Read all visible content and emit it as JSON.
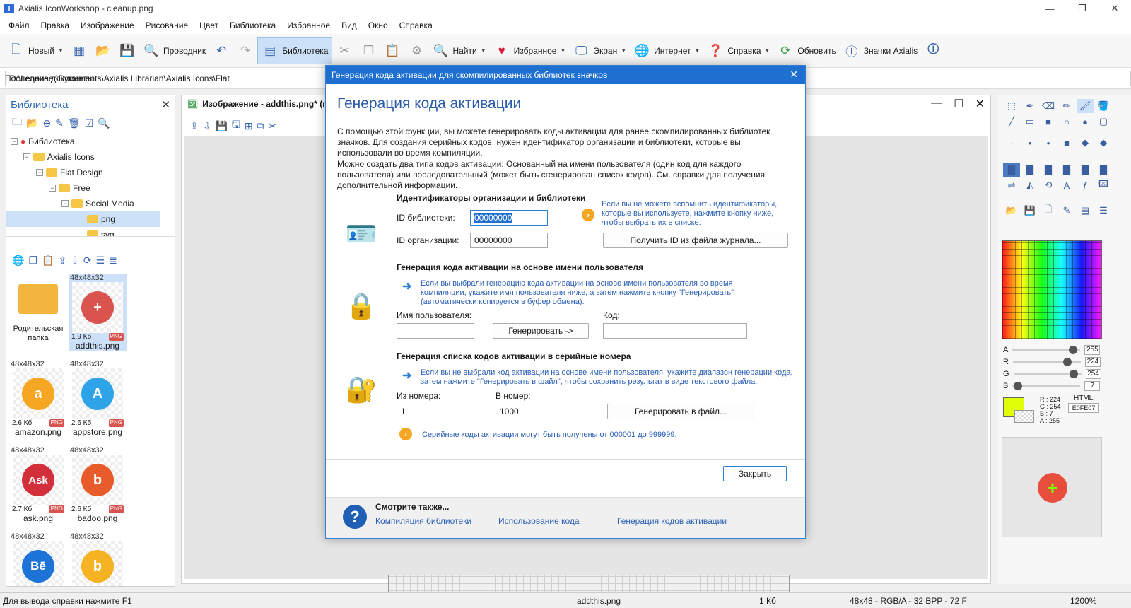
{
  "window": {
    "title": "Axialis IconWorkshop - cleanup.png",
    "app_letter": "I",
    "min": "—",
    "max": "❐",
    "close": "✕"
  },
  "menu": [
    "Файл",
    "Правка",
    "Изображение",
    "Рисование",
    "Цвет",
    "Библиотека",
    "Избранное",
    "Вид",
    "Окно",
    "Справка"
  ],
  "toolbar": {
    "new": "Новый",
    "explorer": "Проводник",
    "library": "Библиотека",
    "find": "Найти",
    "favorites": "Избранное",
    "screen": "Экран",
    "internet": "Интернет",
    "help": "Справка",
    "update": "Обновить",
    "axialis_icons": "Значки Axialis"
  },
  "recent": {
    "label": "Последние документы",
    "path": "D:\\Lenouser\\Documents\\Axialis Librarian\\Axialis Icons\\Flat"
  },
  "library_panel": {
    "title": "Библиотека",
    "tree": [
      "Библиотека",
      "Axialis Icons",
      "Flat Design",
      "Free",
      "Social Media",
      "png",
      "svg"
    ],
    "thumbs": [
      {
        "dim": "",
        "name": "Родительская папка",
        "size": "",
        "type": ""
      },
      {
        "dim": "48x48x32",
        "name": "addthis.png",
        "size": "1.9 Кб",
        "type": "PNG"
      },
      {
        "dim": "48x48x32",
        "name": "amazon.png",
        "size": "2.6 Кб",
        "type": "PNG",
        "glyph": "a"
      },
      {
        "dim": "48x48x32",
        "name": "appstore.png",
        "size": "2.6 Кб",
        "type": "PNG",
        "glyph": "A"
      },
      {
        "dim": "48x48x32",
        "name": "ask.png",
        "size": "2.7 Кб",
        "type": "PNG",
        "glyph": "Ask"
      },
      {
        "dim": "48x48x32",
        "name": "badoo.png",
        "size": "2.6 Кб",
        "type": "PNG",
        "glyph": "b"
      },
      {
        "dim": "48x48x32",
        "name": "",
        "size": "",
        "type": "",
        "glyph": "Bē"
      },
      {
        "dim": "48x48x32",
        "name": "",
        "size": "",
        "type": "",
        "glyph": "b"
      }
    ]
  },
  "document": {
    "title": "Изображение - addthis.png* (r"
  },
  "color_panel": {
    "sliders": [
      {
        "k": "A",
        "v": "255",
        "f": 0.95
      },
      {
        "k": "R",
        "v": "224",
        "f": 0.85
      },
      {
        "k": "G",
        "v": "254",
        "f": 0.95
      },
      {
        "k": "B",
        "v": "7",
        "f": 0.02
      }
    ],
    "rgb": "R : 224\nG : 254\nB : 7\nA : 255",
    "html_label": "HTML:",
    "html_value": "E0FE07",
    "swatch": "#e0fe07"
  },
  "status": {
    "hint": "Для вывода справки нажмите F1",
    "file": "addthis.png",
    "size": "1 Кб",
    "format": "48x48 - RGB/A - 32 BPP - 72 F",
    "zoom": "1200%"
  },
  "dialog": {
    "title": "Генерация кода активации для скомпилированных библиотек значков",
    "heading": "Генерация кода активации",
    "intro1": "С помощью этой функции, вы можете генерировать коды активации для ранее скомпилированных библиотек значков. Для создания серийных кодов, нужен идентификатор организации и библиотеки, которые вы использовали во время компиляции.",
    "intro2": "Можно создать два типа кодов активации: Основанный на имени пользователя (один код для каждого пользователя) или последовательный (может быть сгенерирован список кодов). См. справки для получения дополнительной информации.",
    "ids": {
      "section": "Идентификаторы организации и библиотеки",
      "lib_label": "ID библиотеки:",
      "lib_value": "00000000",
      "org_label": "ID организации:",
      "org_value": "00000000",
      "hint": "Если вы не можете вспомнить идентификаторы, которые вы используете, нажмите кнопку ниже, чтобы выбрать их в списке:",
      "button": "Получить ID из файла журнала..."
    },
    "user": {
      "section": "Генерация кода активации на основе имени пользователя",
      "hint": "Если вы выбрали генерацию кода активации на основе имени пользователя во время компиляции, укажите имя пользователя ниже, а затем нажмите кнопку \"Генерировать\" (автоматически копируется в буфер обмена).",
      "name_label": "Имя пользователя:",
      "name_value": "",
      "button": "Генерировать ->",
      "code_label": "Код:",
      "code_value": ""
    },
    "serial": {
      "section": "Генерация списка кодов активации в серийные номера",
      "hint": "Если вы не выбрали код активации на основе имени пользователя, укажите диапазон генерации кода, затем нажмите \"Генерировать в файл\", чтобы сохранить результат в виде текстового файла.",
      "from_label": "Из номера:",
      "from_value": "1",
      "to_label": "В номер:",
      "to_value": "1000",
      "button": "Генерировать в файл...",
      "note": "Серийные коды активации могут быть получены от 000001 до 999999."
    },
    "close_button": "Закрыть",
    "see_also": "Смотрите также...",
    "links": [
      "Компиляция библиотеки",
      "Использование кода",
      "Генерация кодов активации"
    ]
  }
}
